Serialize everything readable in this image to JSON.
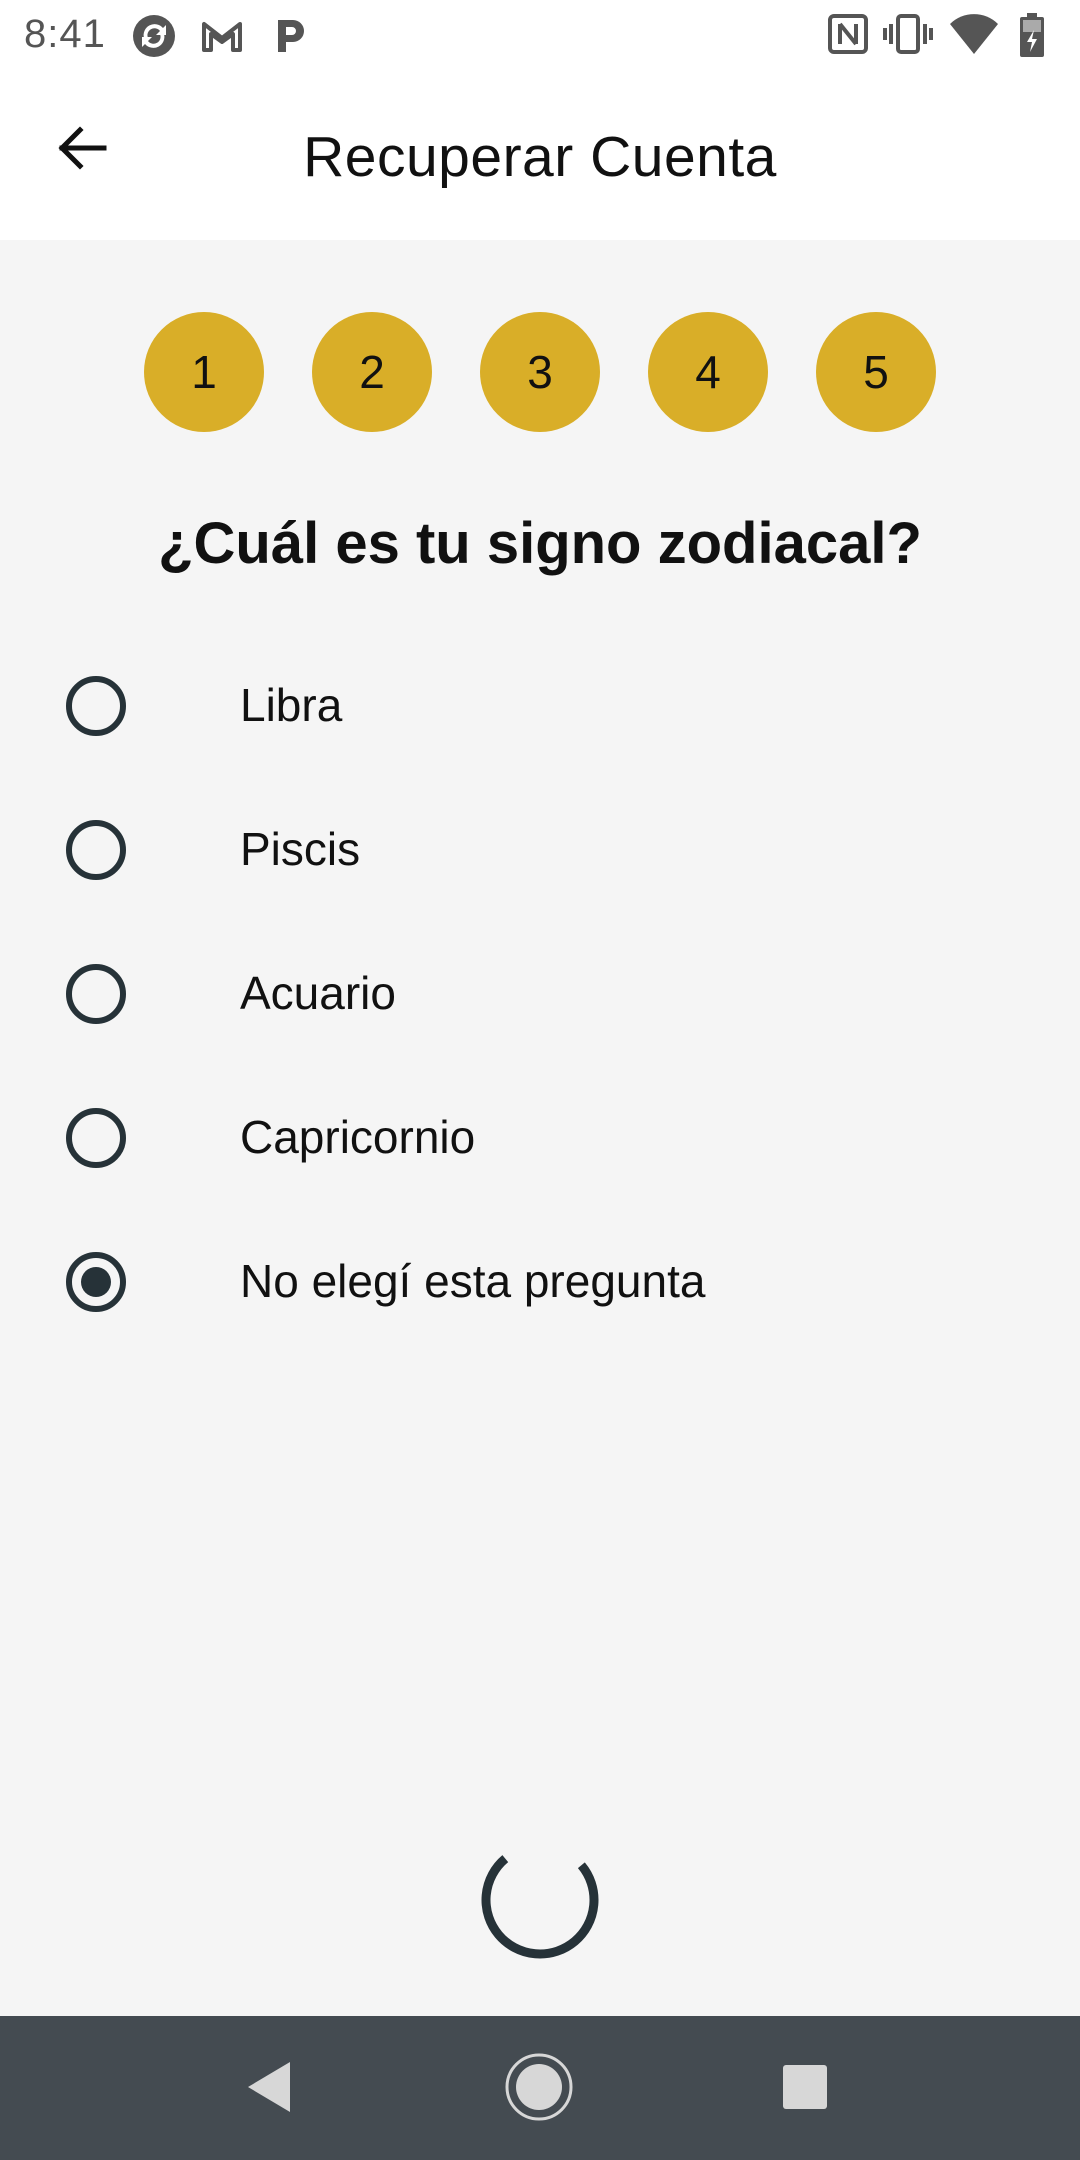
{
  "status_bar": {
    "time": "8:41",
    "notification_icons": [
      "sync-icon",
      "gmail-icon",
      "pandora-icon"
    ],
    "system_icons": [
      "nfc-icon",
      "vibrate-icon",
      "wifi-icon",
      "battery-charging-icon"
    ]
  },
  "app_bar": {
    "title": "Recuperar Cuenta",
    "back_icon": "arrow-left-icon"
  },
  "steps": {
    "items": [
      "1",
      "2",
      "3",
      "4",
      "5"
    ],
    "color": "#d9ae28"
  },
  "question": {
    "text": "¿Cuál es tu signo zodiacal?"
  },
  "options": [
    {
      "label": "Libra",
      "selected": false
    },
    {
      "label": "Piscis",
      "selected": false
    },
    {
      "label": "Acuario",
      "selected": false
    },
    {
      "label": "Capricornio",
      "selected": false
    },
    {
      "label": "No elegí esta pregunta",
      "selected": true
    }
  ],
  "loading": {
    "spinner_icon": "loading-spinner-icon",
    "color": "#263238"
  },
  "nav_bar": {
    "buttons": [
      "nav-back-icon",
      "nav-home-icon",
      "nav-recents-icon"
    ],
    "background": "#444b51"
  }
}
